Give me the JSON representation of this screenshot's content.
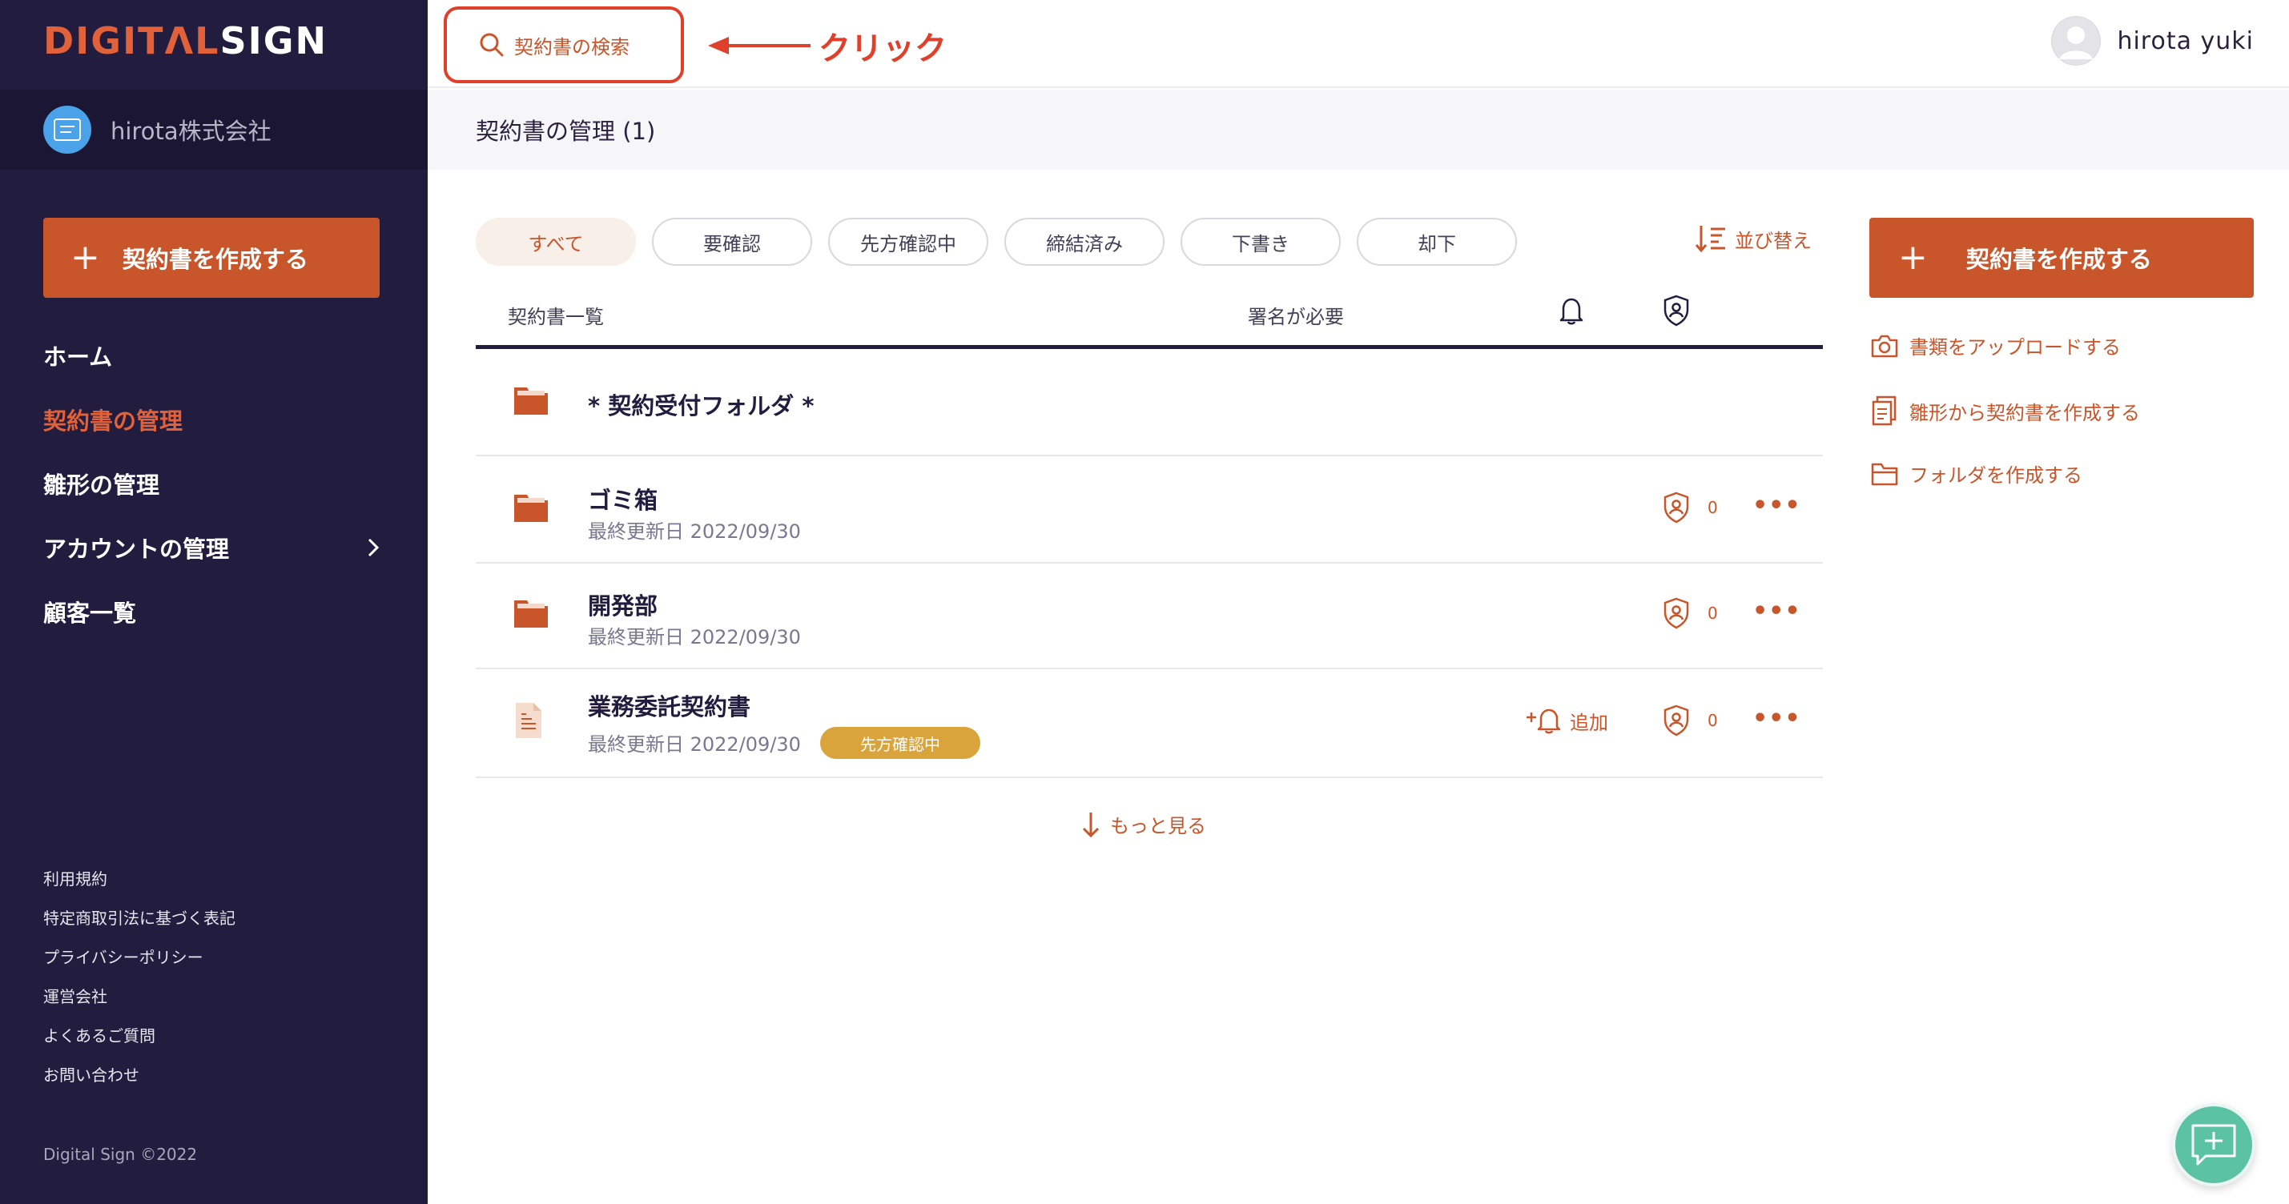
{
  "sidebar": {
    "logo_part1": "DIGIT",
    "logo_part2": "Λ",
    "logo_part3": "L",
    "logo_part4": "SIGN",
    "company_name": "hirota株式会社",
    "create_button": "契約書を作成する",
    "nav": [
      {
        "label": "ホーム"
      },
      {
        "label": "契約書の管理"
      },
      {
        "label": "雛形の管理"
      },
      {
        "label": "アカウントの管理"
      },
      {
        "label": "顧客一覧"
      }
    ],
    "footer_links": [
      "利用規約",
      "特定商取引法に基づく表記",
      "プライバシーポリシー",
      "運営会社",
      "よくあるご質問",
      "お問い合わせ"
    ],
    "copyright": "Digital Sign ©2022"
  },
  "header": {
    "search_label": "契約書の検索",
    "annotation": "クリック",
    "user_name": "hirota yuki"
  },
  "page": {
    "title": "契約書の管理 (1)"
  },
  "filters": [
    "すべて",
    "要確認",
    "先方確認中",
    "締結済み",
    "下書き",
    "却下"
  ],
  "sort_label": "並び替え",
  "table": {
    "col_list": "契約書一覧",
    "col_sign": "署名が必要",
    "rows": [
      {
        "title": "* 契約受付フォルダ *",
        "type": "folder"
      },
      {
        "title": "ゴミ箱",
        "date": "最終更新日 2022/09/30",
        "count": "0",
        "type": "folder"
      },
      {
        "title": "開発部",
        "date": "最終更新日 2022/09/30",
        "count": "0",
        "type": "folder"
      },
      {
        "title": "業務委託契約書",
        "date": "最終更新日 2022/09/30",
        "badge": "先方確認中",
        "add_label": "追加",
        "count": "0",
        "type": "document"
      }
    ]
  },
  "more_label": "もっと見る",
  "right_panel": {
    "create_button": "契約書を作成する",
    "actions": [
      "書類をアップロードする",
      "雛形から契約書を作成する",
      "フォルダを作成する"
    ]
  },
  "colors": {
    "accent": "#c9552a",
    "sidebar": "#221d3e",
    "badge": "#d9a43c",
    "highlight": "#e0402a",
    "fab": "#5cc2a4"
  }
}
